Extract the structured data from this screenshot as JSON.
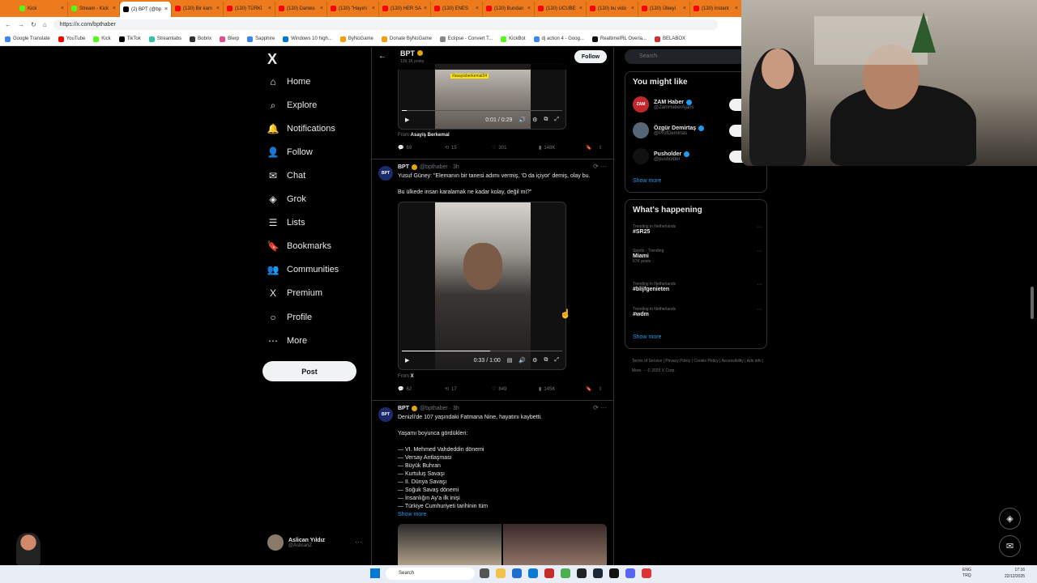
{
  "browser": {
    "tabs": [
      {
        "label": "Kick",
        "color": "#53fc18"
      },
      {
        "label": "Stream - Kick",
        "color": "#53fc18"
      },
      {
        "label": "(2) BPT (@bp",
        "color": "#000000",
        "active": true
      },
      {
        "label": "(130) Bir kam",
        "color": "#ff0000"
      },
      {
        "label": "(130) TÜRKİ",
        "color": "#ff0000"
      },
      {
        "label": "(130) Dantes",
        "color": "#ff0000"
      },
      {
        "label": "(130) \"Hayırlı",
        "color": "#ff0000"
      },
      {
        "label": "(130) HER SA",
        "color": "#ff0000"
      },
      {
        "label": "(130) ENES",
        "color": "#ff0000"
      },
      {
        "label": "(130) Bundan",
        "color": "#ff0000"
      },
      {
        "label": "(130) UCUBE",
        "color": "#ff0000"
      },
      {
        "label": "(130) bu vido",
        "color": "#ff0000"
      },
      {
        "label": "(130) Ülkeyi",
        "color": "#ff0000"
      },
      {
        "label": "(130) Instant",
        "color": "#ff0000"
      }
    ],
    "url": "https://x.com/bpthaber",
    "bookmarks": [
      {
        "label": "Google Translate",
        "color": "#4285f4"
      },
      {
        "label": "YouTube",
        "color": "#ff0000"
      },
      {
        "label": "Kick",
        "color": "#53fc18"
      },
      {
        "label": "TikTok",
        "color": "#000000"
      },
      {
        "label": "Streamlabs",
        "color": "#31c3a2"
      },
      {
        "label": "Bobrix",
        "color": "#333333"
      },
      {
        "label": "Blerp",
        "color": "#e74c8b"
      },
      {
        "label": "Sapphire",
        "color": "#3b82f6"
      },
      {
        "label": "Windows 10 high...",
        "color": "#0078d4"
      },
      {
        "label": "ByNoGame",
        "color": "#f59e0b"
      },
      {
        "label": "Donate ByNoGame",
        "color": "#f59e0b"
      },
      {
        "label": "Eclipse - Convert T...",
        "color": "#888888"
      },
      {
        "label": "KickBot",
        "color": "#53fc18"
      },
      {
        "label": "dj action 4 - Goog...",
        "color": "#4285f4"
      },
      {
        "label": "RealtimeIRL Overla...",
        "color": "#111111"
      },
      {
        "label": "BELABOX",
        "color": "#d32f2f"
      }
    ]
  },
  "nav": {
    "logo": "X",
    "items": [
      {
        "label": "Home",
        "icon": "⌂"
      },
      {
        "label": "Explore",
        "icon": "⌕"
      },
      {
        "label": "Notifications",
        "icon": "🔔"
      },
      {
        "label": "Follow",
        "icon": "👤"
      },
      {
        "label": "Chat",
        "icon": "✉"
      },
      {
        "label": "Grok",
        "icon": "◈"
      },
      {
        "label": "Lists",
        "icon": "☰"
      },
      {
        "label": "Bookmarks",
        "icon": "🔖"
      },
      {
        "label": "Communities",
        "icon": "👥"
      },
      {
        "label": "Premium",
        "icon": "X"
      },
      {
        "label": "Profile",
        "icon": "○"
      },
      {
        "label": "More",
        "icon": "⋯"
      }
    ],
    "post_label": "Post",
    "account": {
      "name": "Aslican Yıldız",
      "handle": "@AslicanZ"
    }
  },
  "feed": {
    "header": {
      "back": "←",
      "title": "BPT",
      "subtitle": "139.1K posts",
      "follow": "Follow"
    },
    "tweet0": {
      "overlay_text": "#asayisberkemal34",
      "time": "0:01 / 0:29",
      "progress": 0.03,
      "from_prefix": "From",
      "from": "Asayiş Berkemal",
      "replies": "69",
      "reposts": "15",
      "likes": "301",
      "views": "148K"
    },
    "tweet1": {
      "name": "BPT",
      "handle": "@bpthaber · 3h",
      "text1": "Yusuf Güney: \"Elemanın bir tanesi adımı vermiş, 'O da içiyor' demiş, olay bu.",
      "text2": "Bu ülkede insan karalamak ne kadar kolay, değil mi?\"",
      "time": "0:33 / 1:00",
      "progress": 0.55,
      "from_prefix": "From",
      "from": "X",
      "replies": "62",
      "reposts": "17",
      "likes": "849",
      "views": "145K"
    },
    "tweet2": {
      "name": "BPT",
      "handle": "@bpthaber · 3h",
      "lines": [
        "Denizli'de 107 yaşındaki Fatmana Nine, hayatını kaybetti.",
        "",
        "Yaşamı boyunca gördükleri:",
        "",
        "— VI. Mehmed Vahdeddin dönemi",
        "— Versay Antlaşması",
        "— Büyük Buhran",
        "— Kurtuluş Savaşı",
        "— II. Dünya Savaşı",
        "— Soğuk Savaş dönemi",
        "— İnsanlığın Ay'a ilk inişi",
        "— Türkiye Cumhuriyeti tarihinin tüm"
      ],
      "show_more": "Show more"
    },
    "avatar_text": "BPT"
  },
  "right": {
    "search_placeholder": "Search",
    "wtf_title": "You might like",
    "wtf": [
      {
        "name": "ZAM Haber",
        "handle": "@ZamHaberAjans",
        "av": "ZAM"
      },
      {
        "name": "Özgür Demirtaş",
        "handle": "@ProfDemirtas",
        "av": ""
      },
      {
        "name": "Pusholder",
        "handle": "@pusholder",
        "av": ""
      }
    ],
    "show_more": "Show more",
    "happening_title": "What's happening",
    "trends": [
      {
        "context": "Trending in Netherlands",
        "title": "#SR25",
        "posts": ""
      },
      {
        "context": "Sports · Trending",
        "title": "Miami",
        "posts": "67K posts"
      },
      {
        "context": "Trending in Netherlands",
        "title": "#blijfgenieten",
        "posts": ""
      },
      {
        "context": "Trending in Netherlands",
        "title": "#wdm",
        "posts": ""
      }
    ],
    "show_more2": "Show more",
    "footer": "Terms of Service  |  Privacy Policy  |  Cookie Policy  |  Accessibility  |  Ads info  |  More ···  © 2025 X Corp."
  },
  "taskbar": {
    "search": "Search",
    "lang": "ENG\nTRQ",
    "time": "17:16",
    "date": "22/12/2025"
  },
  "colors": {
    "accent": "#1d9bf0",
    "brand_orange": "#ed7a1c"
  }
}
